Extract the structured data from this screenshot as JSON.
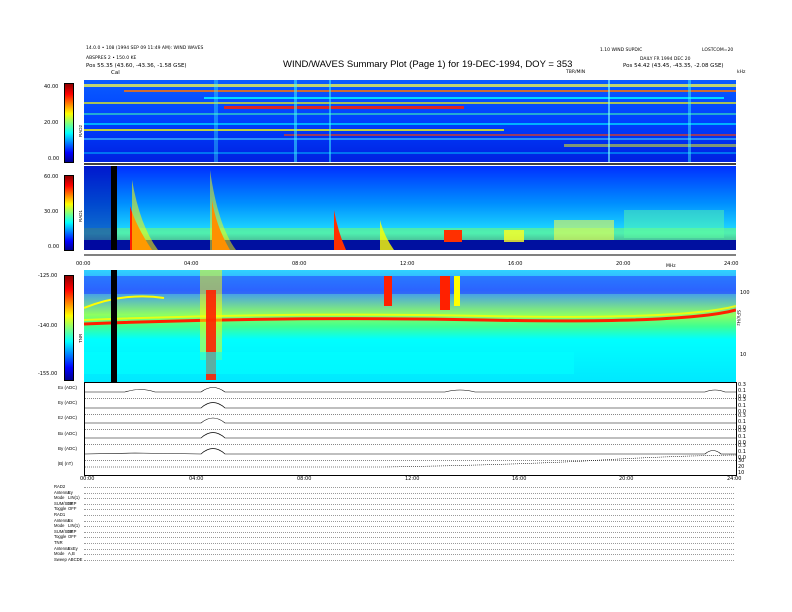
{
  "header": {
    "left_lines": [
      "14.0.0 • 108 (1994 SEP 09 11:49 AM): WIND WAVES",
      "ABSPRES 2 • 150.0 KE",
      "Pos    55.35 (43.60, -43.36, -1.58 GSE)"
    ],
    "title": "WIND/WAVES Summary Plot (Page 1) for 19-DEC-1994, DOY = 353",
    "right_lines": [
      "1.10 WIND  SUPDIC",
      "DAILY  FR 1994 DEC 20",
      "Pos    54.42 (43.45, -43.35, -2.08 GSE)"
    ],
    "top_right_small": "LOSTCOM=20",
    "cal_label": "Cal",
    "tbr_label": "TBR/MIN",
    "khz_label": "kHz",
    "mhz_label": "MHz"
  },
  "rad2": {
    "channel": "RAD2",
    "ticks": [
      "40.00",
      "20.00",
      "0.00"
    ]
  },
  "rad1": {
    "channel": "RAD1",
    "ticks": [
      "60.00",
      "30.00",
      "0.00"
    ]
  },
  "tnr": {
    "channel": "TNR",
    "ticks": [
      "-125.00",
      "-140.00",
      "-155.00"
    ],
    "right_ticks": [
      "100",
      "10"
    ]
  },
  "time_axis": {
    "labels": [
      "00:00",
      "04:00",
      "08:00",
      "12:00",
      "16:00",
      "20:00",
      "24:00"
    ]
  },
  "tnr_right_label": "SFV/Hz",
  "line_panels": [
    {
      "label": "Ex (ADC)",
      "ticks": [
        "0.3",
        "0.1",
        "0.0"
      ]
    },
    {
      "label": "Ey (ADC)",
      "ticks": [
        "0.3",
        "0.1",
        "0.0"
      ]
    },
    {
      "label": "Ez (ADC)",
      "ticks": [
        "0.3",
        "0.1",
        "0.0"
      ]
    },
    {
      "label": "Bx (ADC)",
      "ticks": [
        "0.3",
        "0.1",
        "0.0"
      ]
    },
    {
      "label": "By (ADC)",
      "ticks": [
        "0.3",
        "0.1",
        "0.0"
      ]
    },
    {
      "label": "|B| (nT)",
      "ticks": [
        "30",
        "20",
        "10"
      ]
    }
  ],
  "status_block": [
    {
      "key": "RAD2",
      "value": ""
    },
    {
      "key": "Antenna",
      "value": "Ey"
    },
    {
      "key": "Mode",
      "value": "LIN(1)"
    },
    {
      "key": "SUM/SEP",
      "value": "SEP"
    },
    {
      "key": "Toggle",
      "value": "OFF"
    },
    {
      "key": "RAD1",
      "value": ""
    },
    {
      "key": "Antenna",
      "value": "Ex"
    },
    {
      "key": "Mode",
      "value": "LIN(1)"
    },
    {
      "key": "SUM/SEP",
      "value": "SEP"
    },
    {
      "key": "Toggle",
      "value": "OFF"
    },
    {
      "key": "TNR",
      "value": ""
    },
    {
      "key": "Antenna",
      "value": "ExEy"
    },
    {
      "key": "Mode",
      "value": "A,B"
    },
    {
      "key": "Sweep",
      "value": "ABCDE"
    }
  ],
  "chart_data": [
    {
      "type": "heatmap",
      "title": "WIND/WAVES Summary Plot (Page 1) for 19-DEC-1994, DOY = 353",
      "panels": [
        "RAD2",
        "RAD1",
        "TNR"
      ],
      "x": [
        "00:00",
        "04:00",
        "08:00",
        "12:00",
        "16:00",
        "20:00",
        "24:00"
      ],
      "xlim": [
        0,
        24
      ],
      "rad2_ylim": [
        0,
        40
      ],
      "rad1_ylim": [
        0,
        60
      ],
      "tnr_ylim": [
        -155,
        -125
      ],
      "colorscale": [
        "#00008f",
        "#0000ff",
        "#00ffff",
        "#ffff00",
        "#ff0000",
        "#8f0000"
      ],
      "bursts_hours": [
        1.9,
        4.8,
        5.4,
        9.4,
        11.0,
        13.1,
        14.0,
        17.6,
        19.4
      ]
    }
  ]
}
